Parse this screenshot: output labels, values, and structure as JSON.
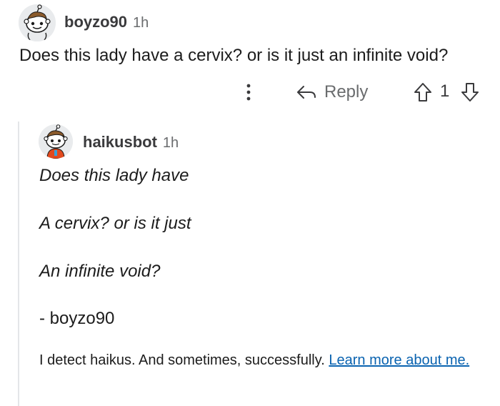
{
  "parent_comment": {
    "username": "boyzo90",
    "timestamp": "1h",
    "body": "Does this lady have a cervix? or is it just an infinite void?",
    "actions": {
      "more_icon": "vertical-dots-icon",
      "reply_label": "Reply",
      "upvote_icon": "upvote-arrow-icon",
      "vote_count": "1",
      "downvote_icon": "downvote-arrow-icon"
    }
  },
  "reply_comment": {
    "username": "haikusbot",
    "timestamp": "1h",
    "haiku_lines": [
      "Does this lady have",
      "A cervix? or is it just",
      "An infinite void?"
    ],
    "signature": "- boyzo90",
    "footer_text": "I detect haikus. And sometimes, successfully.",
    "footer_link": "Learn more about me."
  },
  "colors": {
    "text_primary": "#1c1c1c",
    "text_secondary": "#6a6c6e",
    "link": "#0a63b0",
    "thread_line": "#e4e6e8",
    "avatar_bg": "#e9ebed"
  }
}
